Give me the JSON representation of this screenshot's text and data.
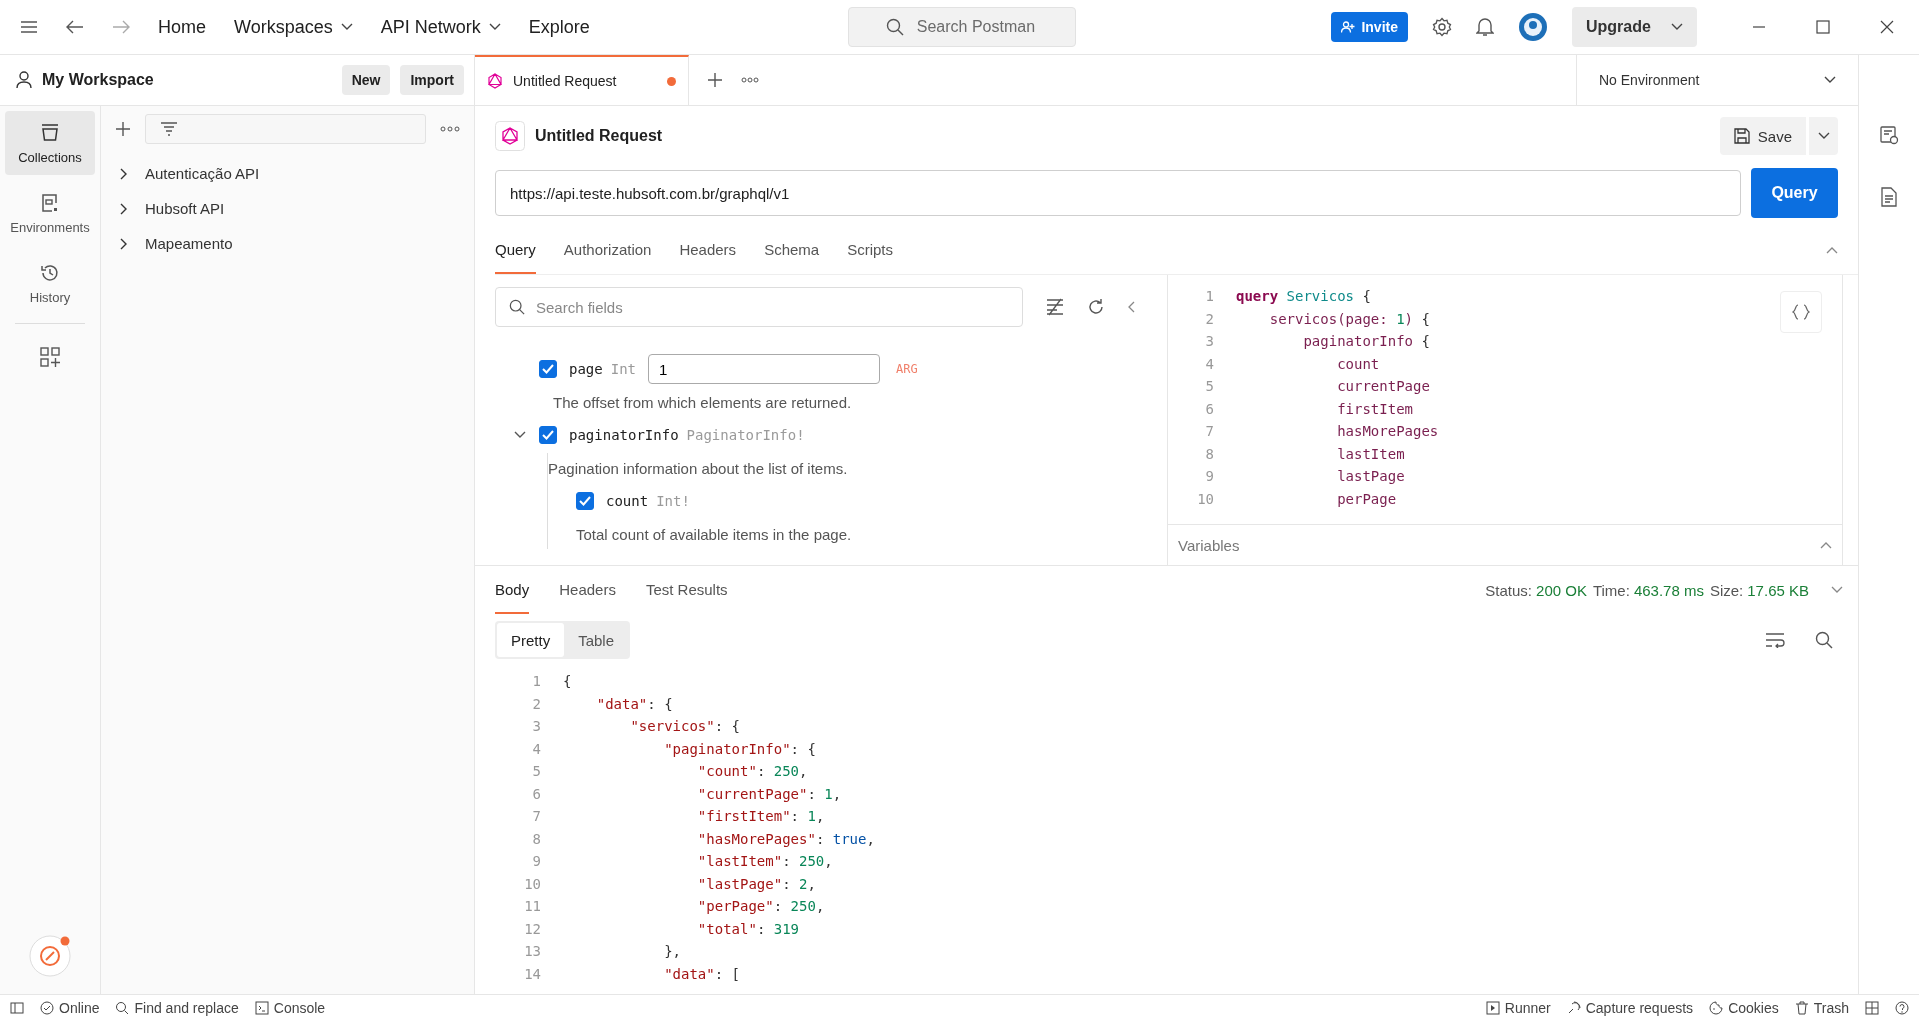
{
  "top_nav": {
    "links": [
      {
        "label": "Home",
        "dropdown": false
      },
      {
        "label": "Workspaces",
        "dropdown": true
      },
      {
        "label": "API Network",
        "dropdown": true
      },
      {
        "label": "Explore",
        "dropdown": false
      }
    ],
    "search": {
      "placeholder": "Search Postman"
    },
    "invite": "Invite",
    "upgrade": "Upgrade"
  },
  "workspace": {
    "name": "My Workspace",
    "new": "New",
    "import": "Import"
  },
  "rail": [
    {
      "label": "Collections",
      "kind": "collections",
      "selected": true
    },
    {
      "label": "Environments",
      "kind": "environments",
      "selected": false
    },
    {
      "label": "History",
      "kind": "history",
      "selected": false
    }
  ],
  "collections": [
    {
      "name": "Autenticação API",
      "expanded": false
    },
    {
      "name": "Hubsoft API",
      "expanded": false
    },
    {
      "name": "Mapeamento",
      "expanded": false
    }
  ],
  "tabs": [
    {
      "label": "Untitled Request",
      "selected": true,
      "unsaved": true
    }
  ],
  "environment": "No Environment",
  "request": {
    "title": "Untitled Request",
    "save": "Save",
    "url": "https://api.teste.hubsoft.com.br/graphql/v1",
    "send": "Query",
    "tabs": [
      {
        "label": "Query",
        "selected": true
      },
      {
        "label": "Authorization",
        "selected": false
      },
      {
        "label": "Headers",
        "selected": false
      },
      {
        "label": "Schema",
        "selected": false
      },
      {
        "label": "Scripts",
        "selected": false
      }
    ]
  },
  "builder": {
    "search_placeholder": "Search fields",
    "items": [
      {
        "kind": "arg",
        "name": "page",
        "type": "Int",
        "checked": true,
        "value": "1",
        "tag": "ARG",
        "description": "The offset from which elements are returned."
      },
      {
        "kind": "field",
        "name": "paginatorInfo",
        "type": "PaginatorInfo!",
        "checked": true,
        "expanded": true,
        "description": "Pagination information about the list of items.",
        "children": [
          {
            "kind": "field",
            "name": "count",
            "type": "Int!",
            "checked": true,
            "description": "Total count of available items in the page."
          }
        ]
      }
    ]
  },
  "query_editor": {
    "lines": [
      {
        "n": "1",
        "tokens": [
          {
            "kind": "keyword",
            "text": "query"
          },
          {
            "kind": "name",
            "text": " Servicos "
          },
          {
            "kind": "punct",
            "text": "{"
          }
        ]
      },
      {
        "n": "2",
        "tokens": [
          {
            "kind": "field",
            "text": "    servicos"
          },
          {
            "kind": "field",
            "text": "(page: "
          },
          {
            "kind": "number",
            "text": "1"
          },
          {
            "kind": "field",
            "text": ") "
          },
          {
            "kind": "punct",
            "text": "{"
          }
        ]
      },
      {
        "n": "3",
        "tokens": [
          {
            "kind": "field",
            "text": "        paginatorInfo "
          },
          {
            "kind": "punct",
            "text": "{"
          }
        ]
      },
      {
        "n": "4",
        "tokens": [
          {
            "kind": "field",
            "text": "            count"
          }
        ]
      },
      {
        "n": "5",
        "tokens": [
          {
            "kind": "field",
            "text": "            currentPage"
          }
        ]
      },
      {
        "n": "6",
        "tokens": [
          {
            "kind": "field",
            "text": "            firstItem"
          }
        ]
      },
      {
        "n": "7",
        "tokens": [
          {
            "kind": "field",
            "text": "            hasMorePages"
          }
        ]
      },
      {
        "n": "8",
        "tokens": [
          {
            "kind": "field",
            "text": "            lastItem"
          }
        ]
      },
      {
        "n": "9",
        "tokens": [
          {
            "kind": "field",
            "text": "            lastPage"
          }
        ]
      },
      {
        "n": "10",
        "tokens": [
          {
            "kind": "field",
            "text": "            perPage"
          }
        ]
      }
    ],
    "variables": "Variables"
  },
  "response": {
    "tabs": [
      {
        "label": "Body",
        "selected": true
      },
      {
        "label": "Headers",
        "selected": false
      },
      {
        "label": "Test Results",
        "selected": false
      }
    ],
    "status_label": "Status:",
    "status": "200 OK",
    "time_label": "Time:",
    "time": "463.78 ms",
    "size_label": "Size:",
    "size": "17.65 KB",
    "views": [
      {
        "label": "Pretty",
        "selected": true
      },
      {
        "label": "Table",
        "selected": false
      }
    ],
    "lines": [
      {
        "n": "1",
        "tokens": [
          {
            "kind": "punct",
            "text": "{"
          }
        ]
      },
      {
        "n": "2",
        "tokens": [
          {
            "kind": "key",
            "text": "    \"data\""
          },
          {
            "kind": "punct",
            "text": ": {"
          }
        ]
      },
      {
        "n": "3",
        "tokens": [
          {
            "kind": "key",
            "text": "        \"servicos\""
          },
          {
            "kind": "punct",
            "text": ": {"
          }
        ]
      },
      {
        "n": "4",
        "tokens": [
          {
            "kind": "key",
            "text": "            \"paginatorInfo\""
          },
          {
            "kind": "punct",
            "text": ": {"
          }
        ]
      },
      {
        "n": "5",
        "tokens": [
          {
            "kind": "key",
            "text": "                \"count\""
          },
          {
            "kind": "punct",
            "text": ": "
          },
          {
            "kind": "number",
            "text": "250"
          },
          {
            "kind": "punct",
            "text": ","
          }
        ]
      },
      {
        "n": "6",
        "tokens": [
          {
            "kind": "key",
            "text": "                \"currentPage\""
          },
          {
            "kind": "punct",
            "text": ": "
          },
          {
            "kind": "number",
            "text": "1"
          },
          {
            "kind": "punct",
            "text": ","
          }
        ]
      },
      {
        "n": "7",
        "tokens": [
          {
            "kind": "key",
            "text": "                \"firstItem\""
          },
          {
            "kind": "punct",
            "text": ": "
          },
          {
            "kind": "number",
            "text": "1"
          },
          {
            "kind": "punct",
            "text": ","
          }
        ]
      },
      {
        "n": "8",
        "tokens": [
          {
            "kind": "key",
            "text": "                \"hasMorePages\""
          },
          {
            "kind": "punct",
            "text": ": "
          },
          {
            "kind": "bool",
            "text": "true"
          },
          {
            "kind": "punct",
            "text": ","
          }
        ]
      },
      {
        "n": "9",
        "tokens": [
          {
            "kind": "key",
            "text": "                \"lastItem\""
          },
          {
            "kind": "punct",
            "text": ": "
          },
          {
            "kind": "number",
            "text": "250"
          },
          {
            "kind": "punct",
            "text": ","
          }
        ]
      },
      {
        "n": "10",
        "tokens": [
          {
            "kind": "key",
            "text": "                \"lastPage\""
          },
          {
            "kind": "punct",
            "text": ": "
          },
          {
            "kind": "number",
            "text": "2"
          },
          {
            "kind": "punct",
            "text": ","
          }
        ]
      },
      {
        "n": "11",
        "tokens": [
          {
            "kind": "key",
            "text": "                \"perPage\""
          },
          {
            "kind": "punct",
            "text": ": "
          },
          {
            "kind": "number",
            "text": "250"
          },
          {
            "kind": "punct",
            "text": ","
          }
        ]
      },
      {
        "n": "12",
        "tokens": [
          {
            "kind": "key",
            "text": "                \"total\""
          },
          {
            "kind": "punct",
            "text": ": "
          },
          {
            "kind": "number",
            "text": "319"
          }
        ]
      },
      {
        "n": "13",
        "tokens": [
          {
            "kind": "punct",
            "text": "            },"
          }
        ]
      },
      {
        "n": "14",
        "tokens": [
          {
            "kind": "key",
            "text": "            \"data\""
          },
          {
            "kind": "punct",
            "text": ": ["
          }
        ]
      }
    ]
  },
  "status_bar": {
    "left": [
      {
        "label": "Online",
        "kind": "online"
      },
      {
        "label": "Find and replace",
        "kind": "find"
      },
      {
        "label": "Console",
        "kind": "console"
      }
    ],
    "right": [
      {
        "label": "Runner",
        "kind": "runner"
      },
      {
        "label": "Capture requests",
        "kind": "capture"
      },
      {
        "label": "Cookies",
        "kind": "cookies"
      },
      {
        "label": "Trash",
        "kind": "trash"
      }
    ]
  }
}
